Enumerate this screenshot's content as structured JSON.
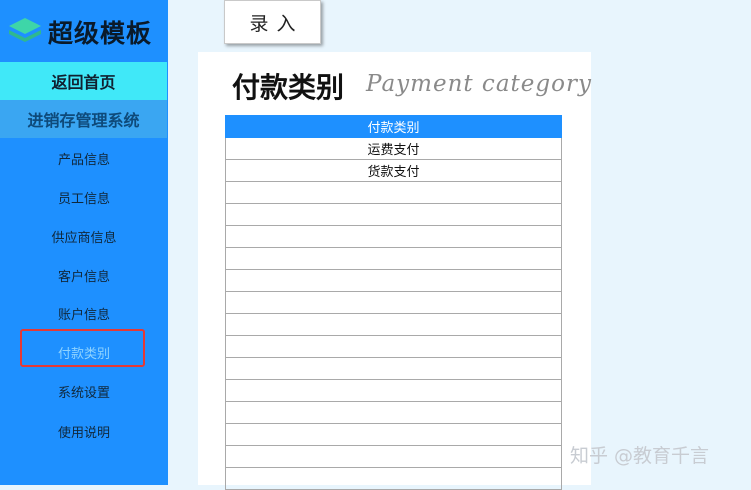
{
  "brand": {
    "logo_text": "超级模板"
  },
  "sidebar": {
    "home_label": "返回首页",
    "system_title": "进销存管理系统",
    "items": [
      {
        "label": "产品信息"
      },
      {
        "label": "员工信息"
      },
      {
        "label": "供应商信息"
      },
      {
        "label": "客户信息"
      },
      {
        "label": "账户信息"
      },
      {
        "label": "付款类别",
        "active": true
      },
      {
        "label": "系统设置"
      },
      {
        "label": "使用说明"
      }
    ]
  },
  "toolbar": {
    "record_label": "录入"
  },
  "main": {
    "title": "付款类别",
    "subtitle": "Payment category",
    "table": {
      "header": "付款类别",
      "rows": [
        "运费支付",
        "货款支付",
        "",
        "",
        "",
        "",
        "",
        "",
        "",
        "",
        "",
        "",
        "",
        "",
        "",
        ""
      ]
    }
  },
  "watermark": "知乎 @教育千言",
  "colors": {
    "sidebar_bg": "#1e90ff",
    "home_bg": "#40e8f8",
    "highlight_border": "#e53935",
    "header_bg": "#1e90ff"
  },
  "icons": {
    "logo": "stacked-layers-icon"
  }
}
